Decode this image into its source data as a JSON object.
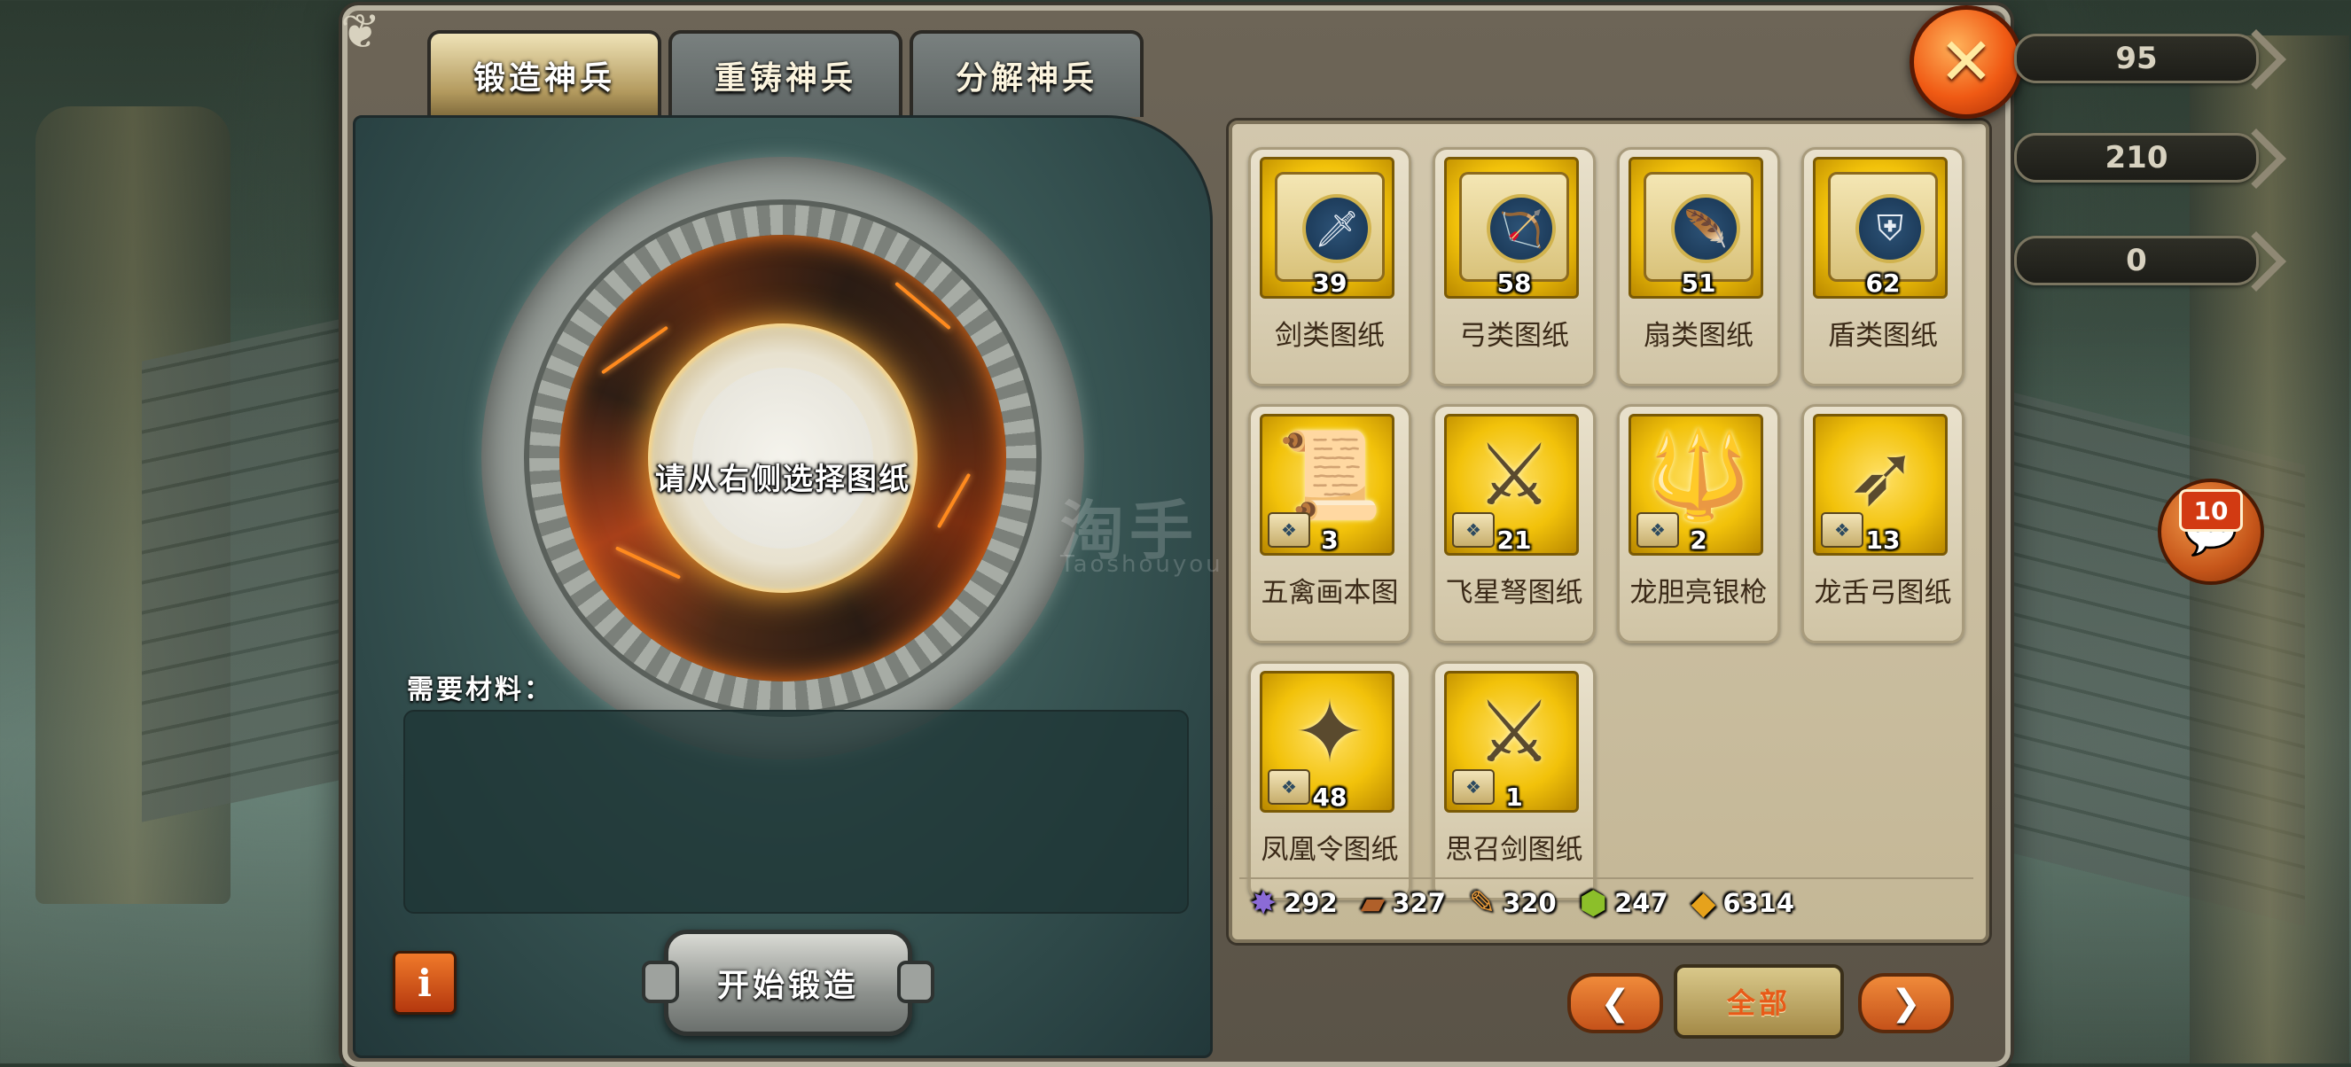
{
  "tabs": [
    {
      "label": "锻造神兵",
      "active": true
    },
    {
      "label": "重铸神兵",
      "active": false
    },
    {
      "label": "分解神兵",
      "active": false
    }
  ],
  "forge": {
    "hint": "请从右侧选择图纸",
    "materials_label": "需要材料：",
    "start_button": "开始锻造",
    "info_button": "i"
  },
  "items": [
    {
      "name": "剑类图纸",
      "count": "39",
      "icon": "sword-blueprint-icon",
      "glyph": "🗡"
    },
    {
      "name": "弓类图纸",
      "count": "58",
      "icon": "bow-blueprint-icon",
      "glyph": "🏹"
    },
    {
      "name": "扇类图纸",
      "count": "51",
      "icon": "fan-blueprint-icon",
      "glyph": "🪶"
    },
    {
      "name": "盾类图纸",
      "count": "62",
      "icon": "shield-blueprint-icon",
      "glyph": "⛨"
    },
    {
      "name": "五禽画本图",
      "count": "3",
      "icon": "scroll-weapon-icon",
      "glyph": "📜"
    },
    {
      "name": "飞星弩图纸",
      "count": "21",
      "icon": "crossbow-weapon-icon",
      "glyph": "⚔"
    },
    {
      "name": "龙胆亮银枪",
      "count": "2",
      "icon": "spear-weapon-icon",
      "glyph": "🔱"
    },
    {
      "name": "龙舌弓图纸",
      "count": "13",
      "icon": "longbow-weapon-icon",
      "glyph": "➶"
    },
    {
      "name": "凤凰令图纸",
      "count": "48",
      "icon": "phoenix-token-icon",
      "glyph": "✦"
    },
    {
      "name": "思召剑图纸",
      "count": "1",
      "icon": "sizhao-sword-icon",
      "glyph": "⚔"
    }
  ],
  "resources": [
    {
      "value": "292",
      "icon": "crystal-icon",
      "glyph": "✸",
      "color": "#8b6bd6"
    },
    {
      "value": "327",
      "icon": "wood-plank-icon",
      "glyph": "▰",
      "color": "#b0602a"
    },
    {
      "value": "320",
      "icon": "feather-icon",
      "glyph": "✎",
      "color": "#e89a3a"
    },
    {
      "value": "247",
      "icon": "green-ingot-icon",
      "glyph": "⬢",
      "color": "#8cbf2a"
    },
    {
      "value": "6314",
      "icon": "gold-ore-icon",
      "glyph": "◆",
      "color": "#e6a21c"
    }
  ],
  "pagination": {
    "prev": "❮",
    "all_label": "全部",
    "next": "❯"
  },
  "close_glyph": "✕",
  "stats": [
    "95",
    "210",
    "0"
  ],
  "chat": {
    "badge": "10",
    "glyph": "💬"
  },
  "watermark": {
    "main": "淘手",
    "sub": "Taoshouyou"
  }
}
